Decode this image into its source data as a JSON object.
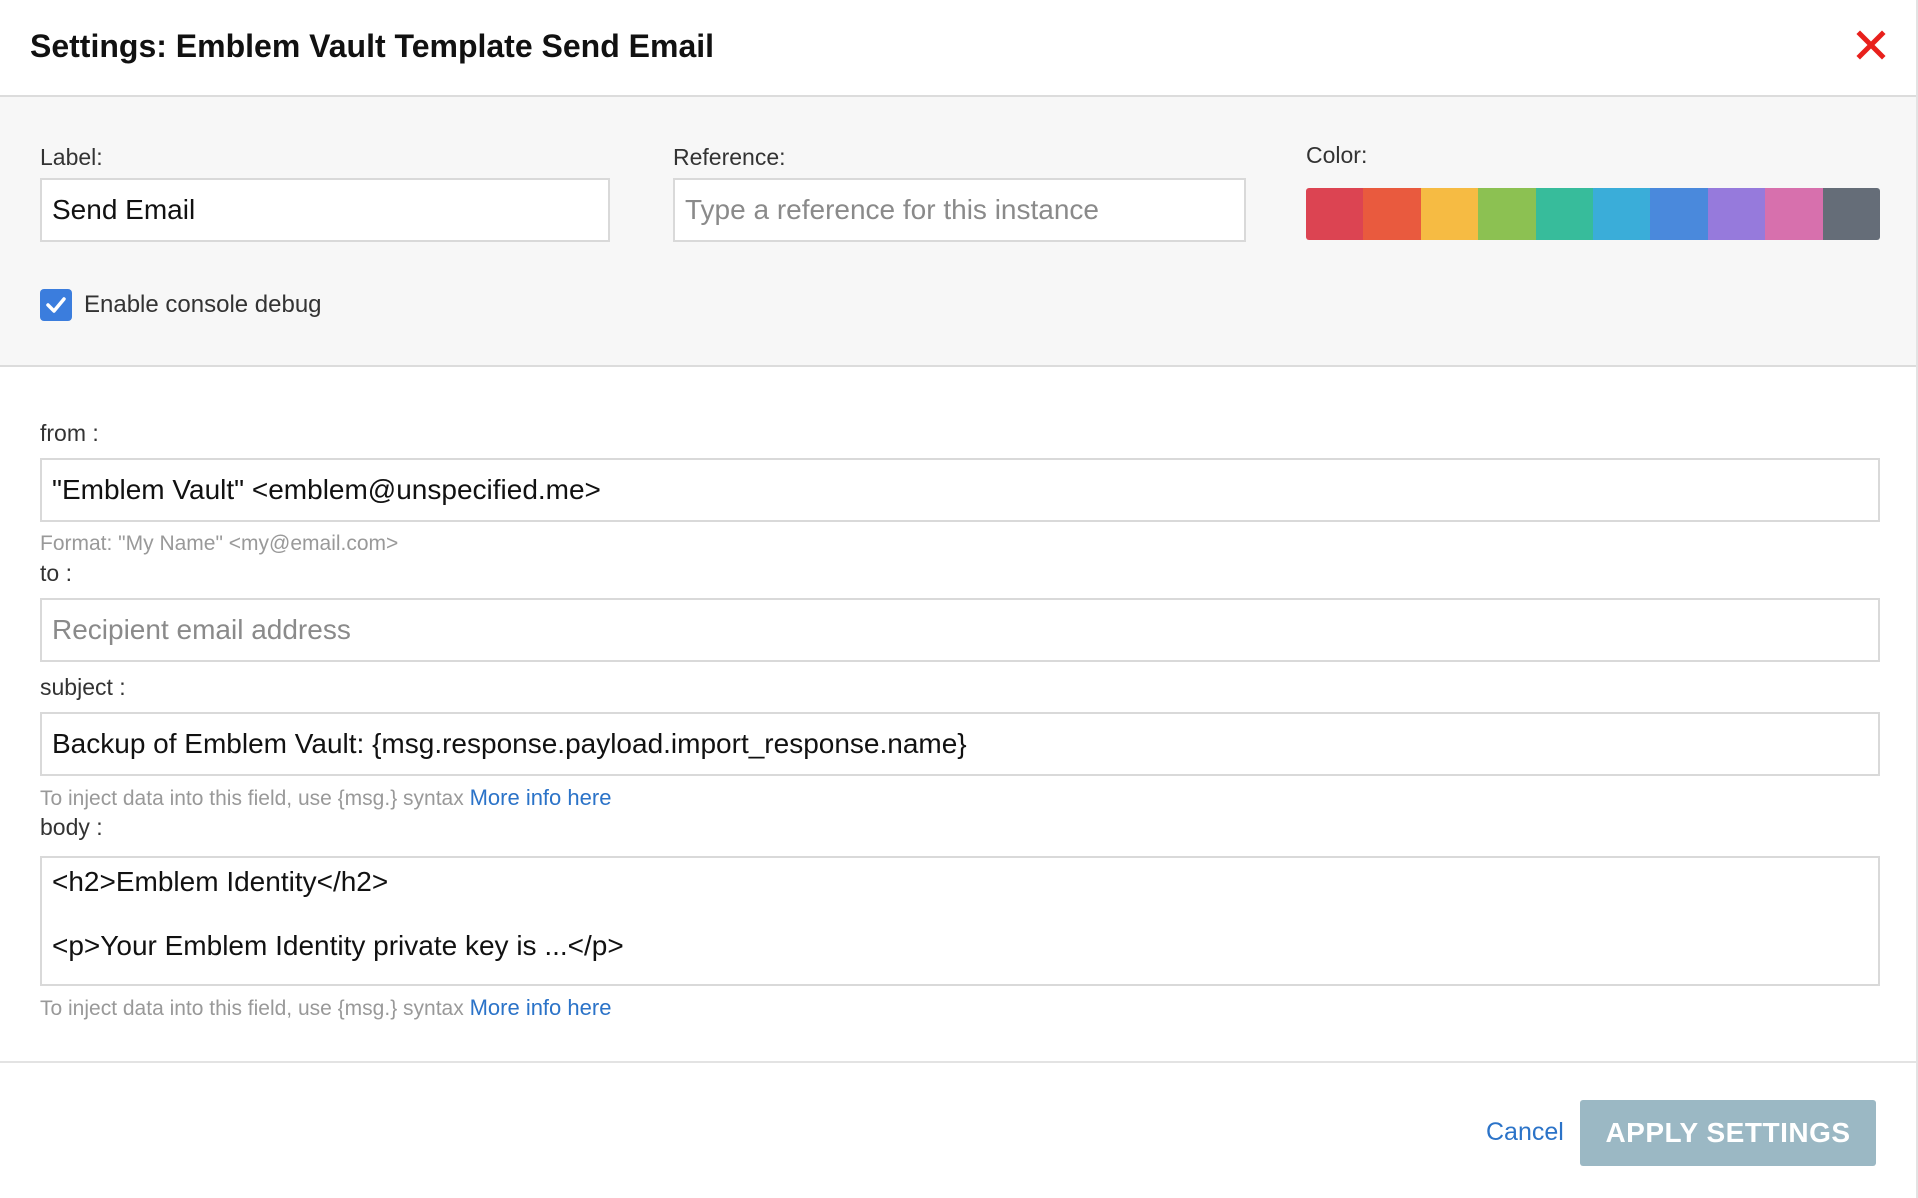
{
  "header": {
    "title": "Settings: Emblem Vault Template Send Email",
    "close_icon": "close-icon",
    "close_color": "#e8201c"
  },
  "general": {
    "label_caption": "Label:",
    "label_value": "Send Email",
    "reference_caption": "Reference:",
    "reference_value": "",
    "reference_placeholder": "Type a reference for this instance",
    "color_caption": "Color:",
    "colors": [
      "#dc4452",
      "#e95a3e",
      "#f6bb43",
      "#8cc152",
      "#37bc9b",
      "#3aadd9",
      "#4a89dc",
      "#967adc",
      "#d770ad",
      "#656d78"
    ],
    "debug_checkbox": {
      "label": "Enable console debug",
      "checked": true,
      "color": "#3b7ddd"
    }
  },
  "fields": {
    "from": {
      "caption": "from :",
      "value": "\"Emblem Vault\" <emblem@unspecified.me>",
      "helper": "Format: \"My Name\" <my@email.com>"
    },
    "to": {
      "caption": "to :",
      "value": "",
      "placeholder": "Recipient email address"
    },
    "subject": {
      "caption": "subject :",
      "value": "Backup of Emblem Vault: {msg.response.payload.import_response.name}",
      "helper": "To inject data into this field, use {msg.} syntax",
      "helper_link": "More info here"
    },
    "body": {
      "caption": "body :",
      "lines": [
        "<h2>Emblem Identity</h2>",
        "",
        "<p>Your Emblem Identity private key is ...</p>"
      ],
      "helper": "To inject data into this field, use {msg.} syntax",
      "helper_link": "More info here"
    }
  },
  "footer": {
    "cancel_label": "Cancel",
    "apply_label": "APPLY SETTINGS",
    "apply_color": "#9bb8c4",
    "link_color": "#2b73c8"
  }
}
